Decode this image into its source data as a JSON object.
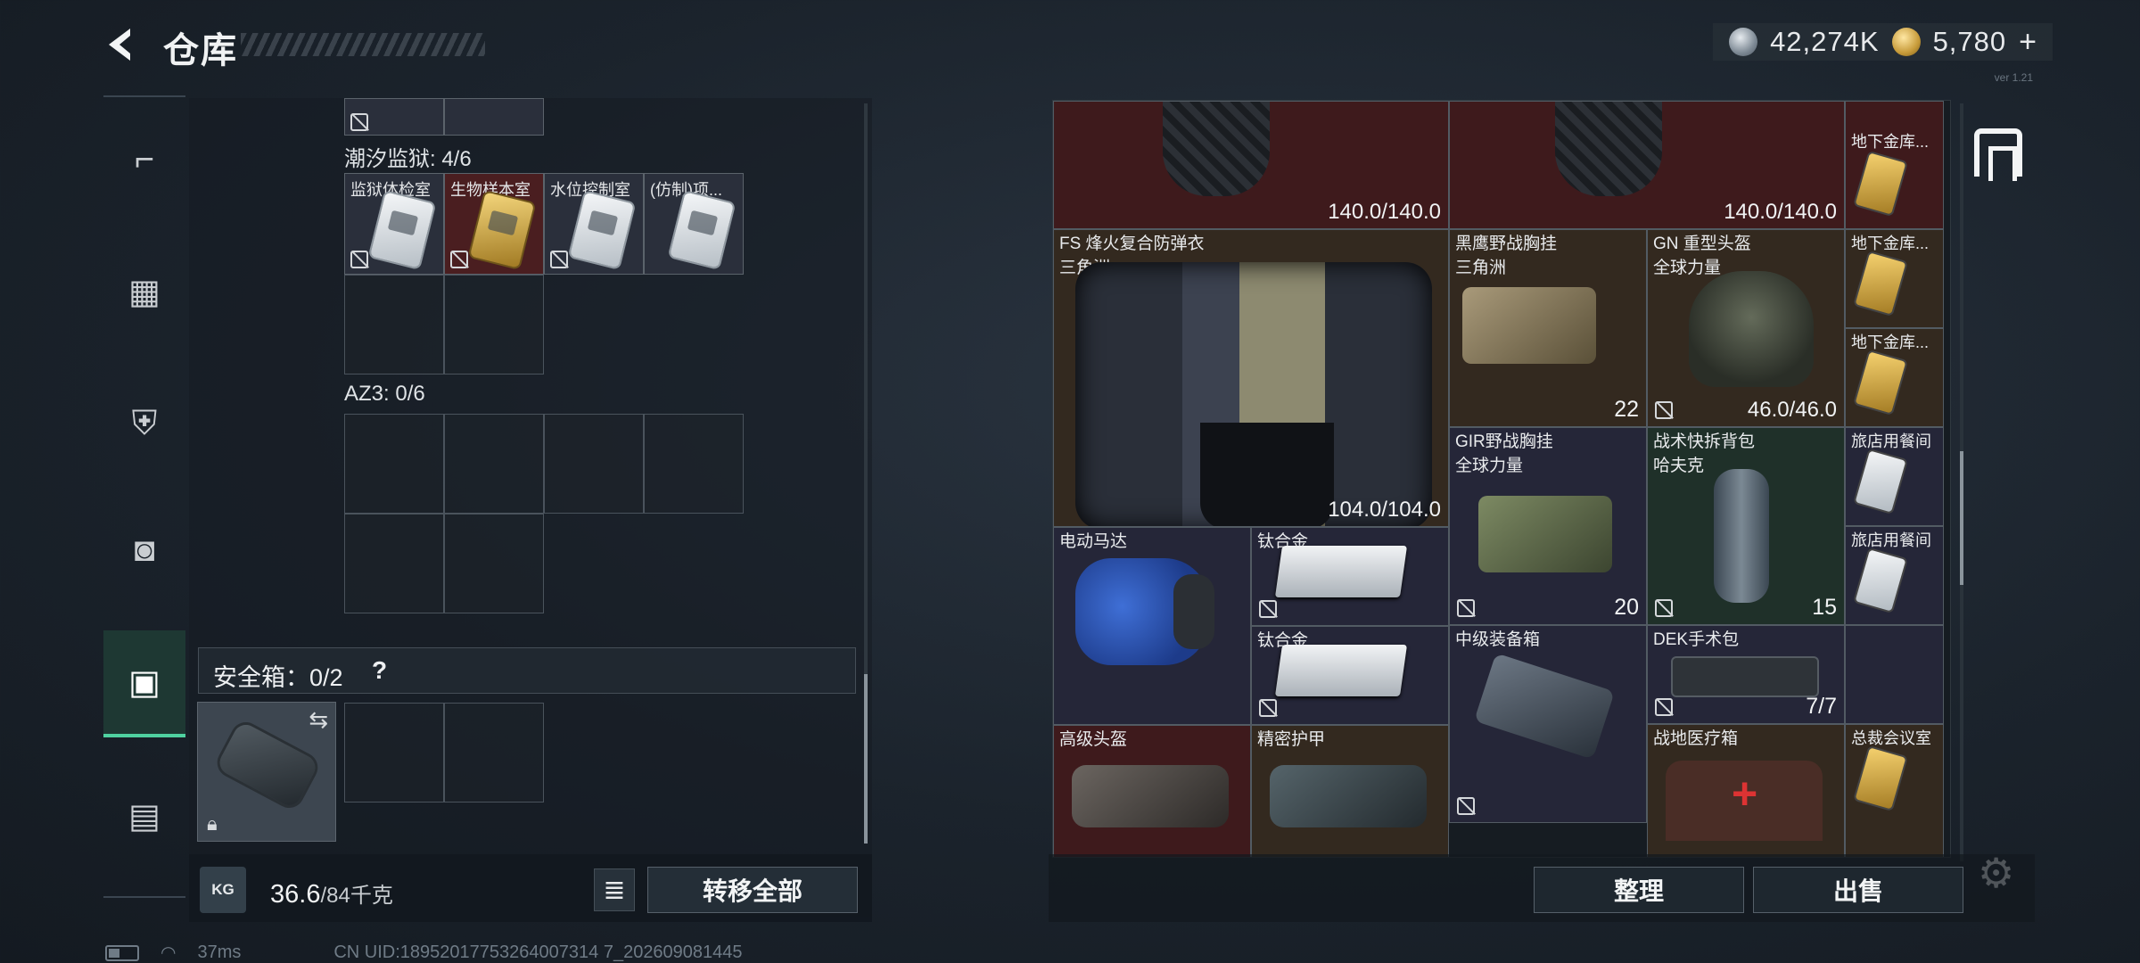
{
  "header": {
    "title": "仓库",
    "currency": {
      "silver": "42,274K",
      "gold": "5,780",
      "gold_plus": "+"
    },
    "version": "ver 1.21"
  },
  "left_panel": {
    "section_prison": "潮汐监狱: 4/6",
    "prison_cards": [
      {
        "label": "监狱体检室"
      },
      {
        "label": "生物样本室"
      },
      {
        "label": "水位控制室"
      },
      {
        "label": "(仿制)项..."
      }
    ],
    "section_az3": "AZ3: 0/6",
    "safebox": {
      "label": "安全箱：0/2",
      "help": "?"
    },
    "weight": {
      "icon": "KG",
      "current": "36.6",
      "capacity": "/84千克"
    },
    "transfer_all": "转移全部"
  },
  "stash": {
    "items": [
      {
        "id": "vest-top-1",
        "dura": "140.0/140.0"
      },
      {
        "id": "vest-top-2",
        "dura": "140.0/140.0"
      },
      {
        "id": "fs-vest",
        "name": "FS 烽火复合防弹衣",
        "sub": "三角洲",
        "dura": "104.0/104.0"
      },
      {
        "id": "black-eagle",
        "name": "黑鹰野战胸挂",
        "sub": "三角洲",
        "count": "22"
      },
      {
        "id": "gn-helmet",
        "name": "GN 重型头盔",
        "sub": "全球力量",
        "dura": "46.0/46.0"
      },
      {
        "id": "gir-rig",
        "name": "GIR野战胸挂",
        "sub": "全球力量",
        "count": "20"
      },
      {
        "id": "tac-bag",
        "name": "战术快拆背包",
        "sub": "哈夫克",
        "count": "15"
      },
      {
        "id": "motor",
        "name": "电动马达"
      },
      {
        "id": "titanium-1",
        "name": "钛合金"
      },
      {
        "id": "titanium-2",
        "name": "钛合金"
      },
      {
        "id": "mid-box",
        "name": "中级装备箱"
      },
      {
        "id": "dek-kit",
        "name": "DEK手术包",
        "count": "7/7"
      },
      {
        "id": "adv-helmet",
        "name": "高级头盔"
      },
      {
        "id": "precision-armor",
        "name": "精密护甲"
      },
      {
        "id": "field-med",
        "name": "战地医疗箱"
      }
    ],
    "side_cards": [
      {
        "name": "地下金库..."
      },
      {
        "name": "地下金库..."
      },
      {
        "name": "地下金库..."
      },
      {
        "name": "旅店用餐间"
      },
      {
        "name": "旅店用餐间"
      },
      {
        "name": "总裁会议室"
      }
    ],
    "organize": "整理",
    "sell": "出售"
  },
  "status": {
    "ping": "37ms",
    "uid": "CN UID:18952017753264007314 7_202609081445"
  }
}
